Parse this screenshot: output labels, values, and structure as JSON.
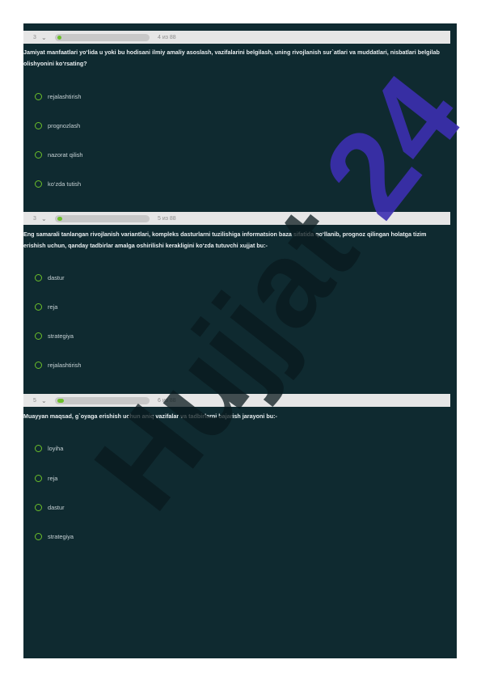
{
  "questions": [
    {
      "number": "3",
      "counter": "4 из 88",
      "progress": 0.045,
      "text": "Jamiyat manfaatlari yo‘lida u yoki bu hodisani ilmiy amaliy asoslash, vazifalarini belgilash, uning rivojlanish sur`atlari va muddatlari, nisbatlari belgilab olishyonini ko‘rsating?",
      "options": [
        "rejalashtirish",
        "prognozlash",
        "nazorat qilish",
        "ko‘zda tutish"
      ]
    },
    {
      "number": "3",
      "counter": "5 из 88",
      "progress": 0.057,
      "text": "Eng samarali tanlangan rivojlanish variantlari, kompleks dasturlarni tuzilishiga informatsion baza sifatida qo‘llanib, prognoz qilingan holatga tizim erishish uchun, qanday tadbirlar amalga oshirilishi kerakligini ko‘zda tutuvchi xujjat bu:-",
      "options": [
        "dastur",
        "reja",
        "strategiya",
        "rejalashtirish"
      ]
    },
    {
      "number": "5",
      "counter": "6 из 88",
      "progress": 0.068,
      "text": "Muayyan maqsad, g`oyaga erishish uchun aniq vazifalar va tadbirlarni bajarish jarayoni bu:-",
      "options": [
        "loyiha",
        "reja",
        "dastur",
        "strategiya"
      ]
    }
  ],
  "watermark": "Hujjat24",
  "colors": {
    "panel": "#0f2a30",
    "accent": "#6cbf2a",
    "watermark_dark": "#0a1a1e",
    "watermark_purple": "#3c2fb0"
  },
  "icons": {
    "dropdown": "chevron-down-icon",
    "option": "radio-circle-icon"
  }
}
